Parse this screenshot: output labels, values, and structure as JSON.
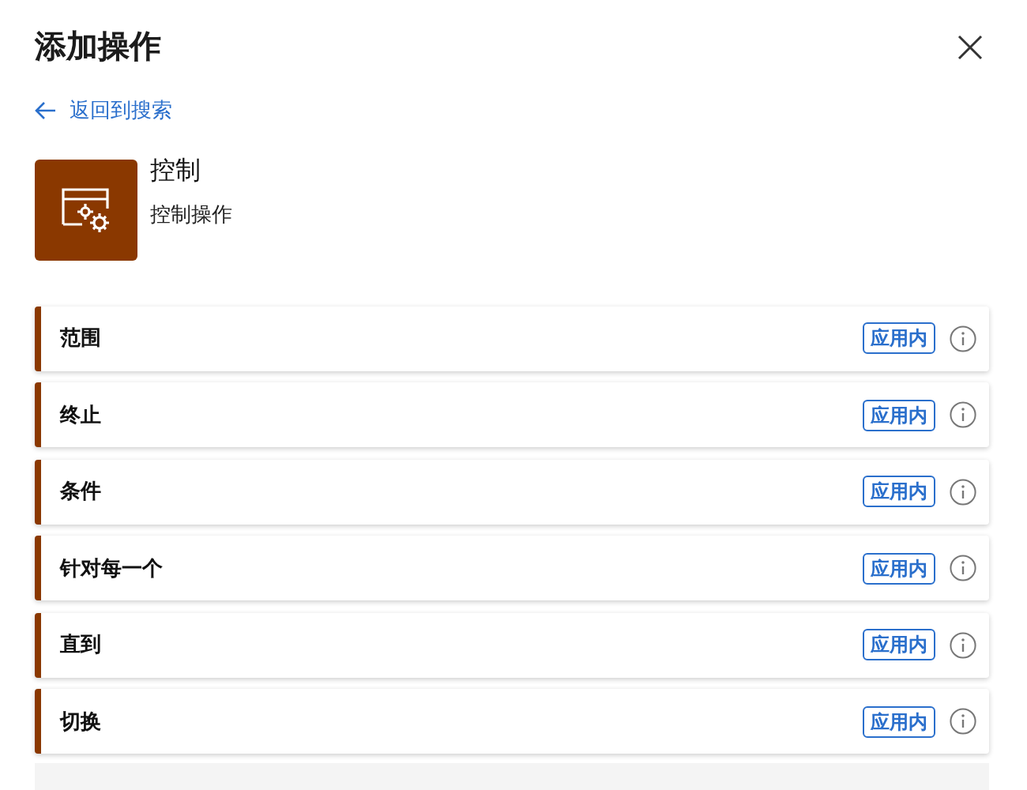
{
  "panel": {
    "title": "添加操作",
    "back_link": "返回到搜索"
  },
  "connector": {
    "name": "控制",
    "description": "控制操作"
  },
  "actions": [
    {
      "label": "范围",
      "badge": "应用内"
    },
    {
      "label": "终止",
      "badge": "应用内"
    },
    {
      "label": "条件",
      "badge": "应用内"
    },
    {
      "label": "针对每一个",
      "badge": "应用内"
    },
    {
      "label": "直到",
      "badge": "应用内"
    },
    {
      "label": "切换",
      "badge": "应用内"
    }
  ]
}
